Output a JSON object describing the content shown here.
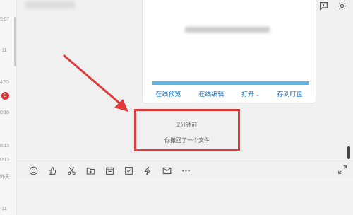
{
  "left_list": {
    "times": [
      "5:07",
      "-11",
      "4:35",
      "0:16",
      "8:13",
      "0:13",
      "昨天",
      "-11"
    ],
    "badge": "3"
  },
  "file_card": {
    "progress_percent": 100,
    "actions": [
      "在线预览",
      "在线编辑",
      "打开",
      "存到盯盘"
    ]
  },
  "chat": {
    "time_text": "2分钟前",
    "recall_text": "你撤回了一个文件"
  },
  "icons": {
    "top_toolbar": [
      "folder-icon",
      "add-user-icon",
      "chat-icon",
      "gear-icon"
    ],
    "input_toolbar": [
      "emoji-icon",
      "thumbs-up-icon",
      "scissors-icon",
      "folder-add-icon",
      "calendar-icon",
      "checkbox-icon",
      "lightning-icon",
      "mail-icon",
      "more-icon"
    ]
  },
  "colors": {
    "accent_blue": "#1d78c8",
    "annotation_red": "#e03a3a"
  }
}
